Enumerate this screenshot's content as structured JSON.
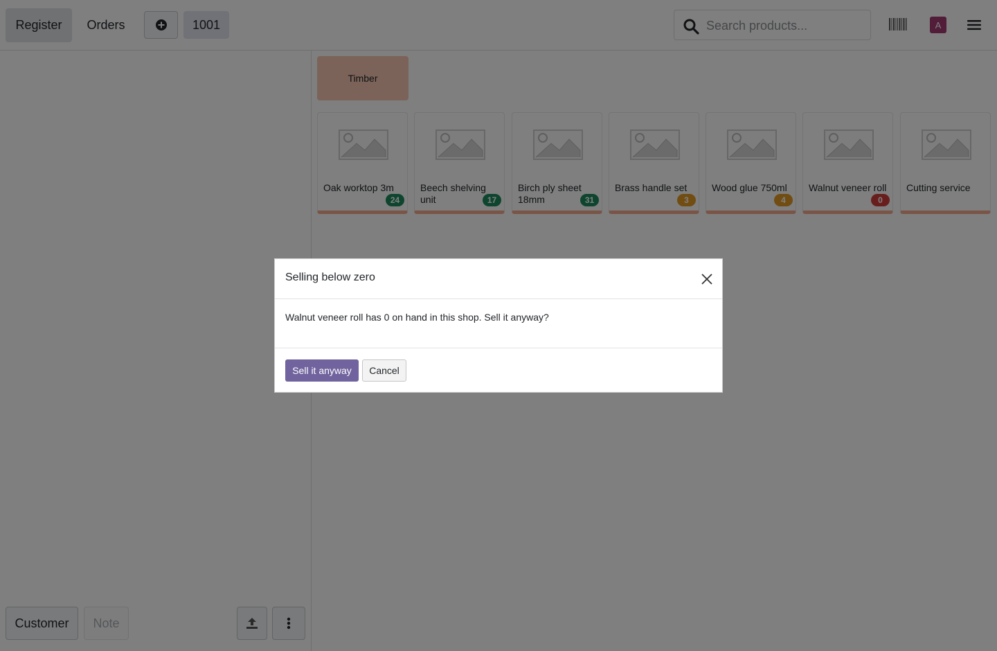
{
  "topbar": {
    "register_label": "Register",
    "orders_label": "Orders",
    "add_order_icon": "plus-circle-icon",
    "order_number": "1001",
    "search_placeholder": "Search products...",
    "search_value": "",
    "avatar_initial": "A",
    "avatar_color": "#a33a73"
  },
  "categories": [
    {
      "label": "Timber",
      "color": "#f7c6b3"
    }
  ],
  "products": [
    {
      "name": "Oak worktop 3m",
      "stock": "24",
      "stock_status": "ok"
    },
    {
      "name": "Beech shelving unit",
      "stock": "17",
      "stock_status": "ok"
    },
    {
      "name": "Birch ply sheet 18mm",
      "stock": "31",
      "stock_status": "ok"
    },
    {
      "name": "Brass handle set",
      "stock": "3",
      "stock_status": "low"
    },
    {
      "name": "Wood glue 750ml",
      "stock": "4",
      "stock_status": "low"
    },
    {
      "name": "Walnut veneer roll",
      "stock": "0",
      "stock_status": "out"
    },
    {
      "name": "Cutting service",
      "stock": null,
      "stock_status": "none"
    }
  ],
  "stock_colors": {
    "ok": "#1c8a5e",
    "low": "#e29a24",
    "out": "#d23d3d"
  },
  "leftpane": {
    "customer_label": "Customer",
    "note_label": "Note"
  },
  "dialog": {
    "title": "Selling below zero",
    "body": "Walnut veneer roll has 0 on hand in this shop. Sell it anyway?",
    "confirm_label": "Sell it anyway",
    "cancel_label": "Cancel"
  },
  "colors": {
    "primary": "#71639e",
    "overlay": "rgba(0,0,0,0.5)"
  }
}
